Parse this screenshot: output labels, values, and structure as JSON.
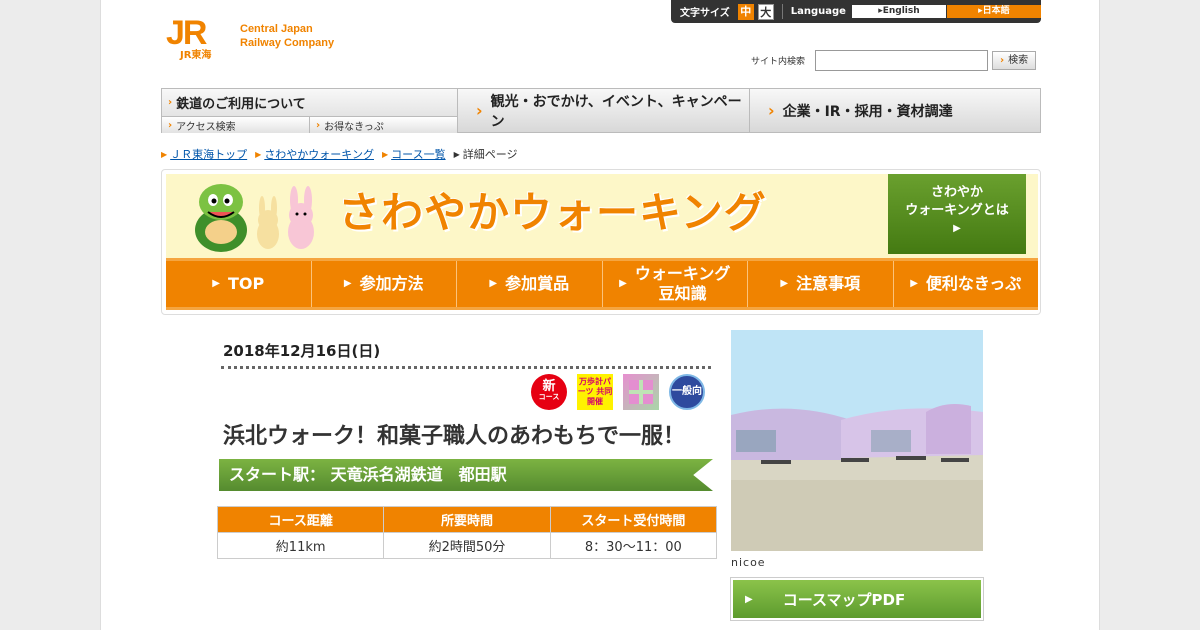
{
  "header": {
    "logo_mark": "JR",
    "logo_sub": "JR東海",
    "logo_line1": "Central Japan",
    "logo_line2": "Railway Company",
    "font_size_label": "文字サイズ",
    "size_mid": "中",
    "size_large": "大",
    "language_label": "Language",
    "lang_en": "English",
    "lang_ja": "日本語",
    "search_label": "サイト内検索",
    "search_value": "",
    "search_button": "検索"
  },
  "gnav": {
    "railway_use": "鉄道のご利用について",
    "access_search": "アクセス検索",
    "discount_tickets": "お得なきっぷ",
    "sightseeing": "観光・おでかけ、イベント、キャンペーン",
    "corporate": "企業・IR・採用・資材調達"
  },
  "breadcrumb": {
    "top": "ＪＲ東海トップ",
    "walking": "さわやかウォーキング",
    "course_list": "コース一覧",
    "current": "詳細ページ"
  },
  "banner": {
    "title": "さわやかウォーキング",
    "what_line1": "さわやか",
    "what_line2": "ウォーキングとは",
    "menu": [
      {
        "label": "TOP"
      },
      {
        "label": "参加方法"
      },
      {
        "label": "参加賞品"
      },
      {
        "label": "ウォーキング\n豆知識"
      },
      {
        "label": "注意事項"
      },
      {
        "label": "便利なきっぷ"
      }
    ]
  },
  "course": {
    "date": "2018年12月16日(日)",
    "badge_new_main": "新",
    "badge_new_sub": "コース",
    "badge_cross": "万歩計パーツ 共同開催",
    "badge_general": "一般向",
    "title": "浜北ウォーク！和菓子職人のあわもちで一服！",
    "start": "スタート駅：  天竜浜名湖鉄道　都田駅",
    "table_headers": [
      "コース距離",
      "所要時間",
      "スタート受付時間"
    ],
    "table_values": [
      "約11km",
      "約2時間50分",
      "8：30～11：00"
    ],
    "photo_caption": "nicoe",
    "map_button": "コースマップPDF"
  },
  "colors": {
    "accent_orange": "#f08300",
    "green": "#6aa02e",
    "banner_bg": "#fdf7c8"
  }
}
